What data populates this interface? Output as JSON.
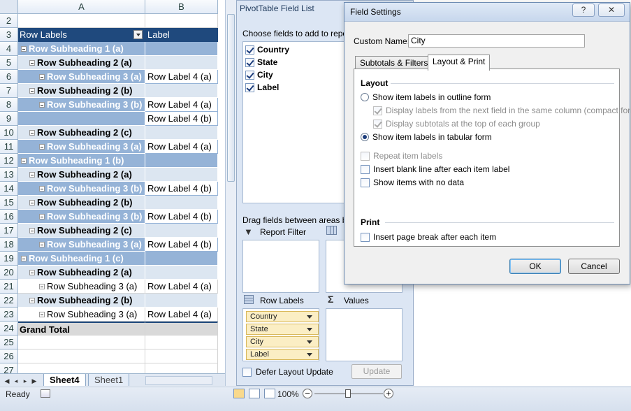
{
  "sheet": {
    "columns": [
      "A",
      "B"
    ],
    "row_numbers": [
      "2",
      "3",
      "4",
      "5",
      "6",
      "7",
      "8",
      "9",
      "10",
      "11",
      "12",
      "13",
      "14",
      "15",
      "16",
      "17",
      "18",
      "19",
      "20",
      "21",
      "22",
      "23",
      "24",
      "25",
      "26",
      "27"
    ],
    "header": {
      "row_labels": "Row Labels",
      "label": "Label"
    },
    "rows": [
      {
        "level": "l1",
        "a": "Row Subheading 1 (a)",
        "b": ""
      },
      {
        "level": "l2",
        "a": "Row Subheading 2 (a)",
        "b": ""
      },
      {
        "level": "l3",
        "a": "Row Subheading 3 (a)",
        "b": "Row Label 4 (a)"
      },
      {
        "level": "l2",
        "a": "Row Subheading 2 (b)",
        "b": ""
      },
      {
        "level": "l3",
        "a": "Row Subheading 3 (b)",
        "b": "Row Label 4 (a)"
      },
      {
        "level": "l3c",
        "a": "",
        "b": "Row Label 4 (b)"
      },
      {
        "level": "l2",
        "a": "Row Subheading 2 (c)",
        "b": ""
      },
      {
        "level": "l3",
        "a": "Row Subheading 3 (a)",
        "b": "Row Label 4 (a)"
      },
      {
        "level": "l1",
        "a": "Row Subheading 1 (b)",
        "b": ""
      },
      {
        "level": "l2",
        "a": "Row Subheading 2 (a)",
        "b": ""
      },
      {
        "level": "l3",
        "a": "Row Subheading 3 (b)",
        "b": "Row Label 4 (b)"
      },
      {
        "level": "l2",
        "a": "Row Subheading 2 (b)",
        "b": ""
      },
      {
        "level": "l3",
        "a": "Row Subheading 3 (b)",
        "b": "Row Label 4 (b)"
      },
      {
        "level": "l2",
        "a": "Row Subheading 2 (c)",
        "b": ""
      },
      {
        "level": "l3",
        "a": "Row Subheading 3 (a)",
        "b": "Row Label 4 (b)"
      },
      {
        "level": "l1",
        "a": "Row Subheading 1 (c)",
        "b": ""
      },
      {
        "level": "l2",
        "a": "Row Subheading 2 (a)",
        "b": ""
      },
      {
        "level": "l3w",
        "a": "Row Subheading 3 (a)",
        "b": "Row Label 4 (a)"
      },
      {
        "level": "l2",
        "a": "Row Subheading 2 (b)",
        "b": ""
      },
      {
        "level": "l3w",
        "a": "Row Subheading 3 (a)",
        "b": "Row Label 4 (a)"
      }
    ],
    "grand_total": "Grand Total",
    "tabs": [
      "Sheet4",
      "Sheet1"
    ],
    "status": "Ready",
    "zoom": "100%"
  },
  "fieldlist": {
    "title": "PivotTable Field List",
    "choose_text": "Choose fields to add to report",
    "fields": [
      {
        "name": "Country",
        "checked": true
      },
      {
        "name": "State",
        "checked": true
      },
      {
        "name": "City",
        "checked": true
      },
      {
        "name": "Label",
        "checked": true
      }
    ],
    "drag_text": "Drag fields between areas below",
    "report_filter": "Report Filter",
    "row_labels": "Row Labels",
    "values": "Values",
    "row_chips": [
      "Country",
      "State",
      "City",
      "Label"
    ],
    "defer_label": "Defer Layout Update",
    "update_button": "Update"
  },
  "dialog": {
    "title": "Field Settings",
    "help": "?",
    "close": "✕",
    "custom_name_label": "Custom Name:",
    "custom_name_value": "City",
    "tabs": [
      "Subtotals & Filters",
      "Layout & Print"
    ],
    "layout_header": "Layout",
    "outline_form": "Show item labels in outline form",
    "compact_form": "Display labels from the next field in the same column (compact form)",
    "subtotals_top": "Display subtotals at the top of each group",
    "tabular_form": "Show item labels in tabular form",
    "repeat_labels": "Repeat item labels",
    "blank_line": "Insert blank line after each item label",
    "no_data": "Show items with no data",
    "print_header": "Print",
    "page_break": "Insert page break after each item",
    "ok": "OK",
    "cancel": "Cancel"
  }
}
